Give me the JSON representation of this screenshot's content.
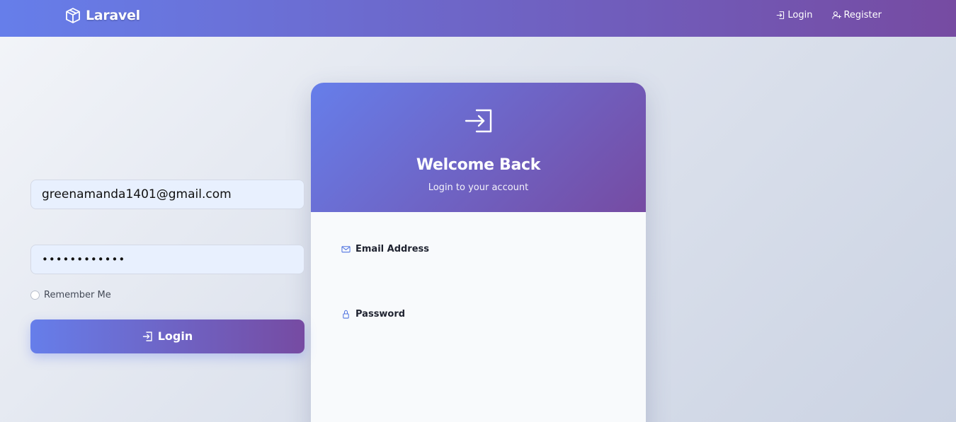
{
  "navbar": {
    "brand": "Laravel",
    "brand_icon": "box-icon",
    "links": [
      {
        "label": "Login",
        "icon": "login-icon"
      },
      {
        "label": "Register",
        "icon": "user-plus-icon"
      }
    ],
    "gradient": [
      "#667eea",
      "#764ba2"
    ]
  },
  "card": {
    "header_icon": "login-icon",
    "title": "Welcome Back",
    "subtitle": "Login to your account",
    "email": {
      "label": "Email Address",
      "icon": "envelope-icon",
      "value": "greenamanda1401@gmail.com"
    },
    "password": {
      "label": "Password",
      "icon": "lock-icon",
      "value": "••••••••••••"
    },
    "remember_label": "Remember Me",
    "submit_label": "Login"
  },
  "colors": {
    "accent_start": "#667eea",
    "accent_end": "#764ba2",
    "input_bg": "#e8f0fe"
  }
}
